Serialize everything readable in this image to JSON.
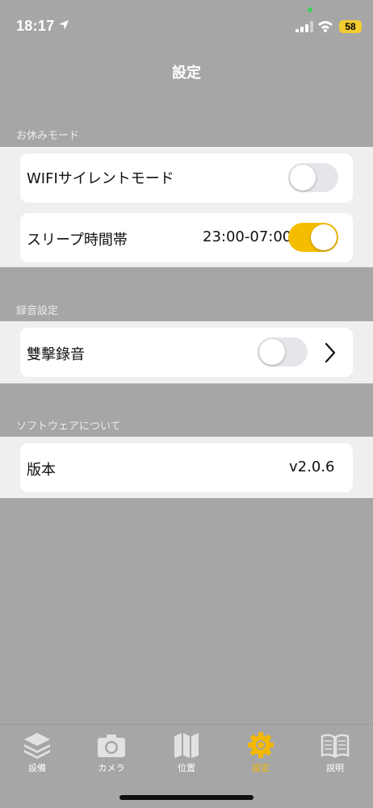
{
  "status_bar": {
    "time": "18:17",
    "battery": "58"
  },
  "header": {
    "title": "設定"
  },
  "sections": [
    {
      "header": "お休みモード",
      "rows": [
        {
          "label": "WIFIサイレントモード",
          "toggle": false
        },
        {
          "label": "スリープ時間帯",
          "value": "23:00-07:00",
          "toggle": true
        }
      ]
    },
    {
      "header": "録音設定",
      "rows": [
        {
          "label": "雙擊錄音",
          "toggle": false,
          "chevron": true
        }
      ]
    },
    {
      "header": "ソフトウェアについて",
      "rows": [
        {
          "label": "版本",
          "value": "v2.0.6"
        }
      ]
    }
  ],
  "tabbar": {
    "tabs": [
      {
        "label": "設備",
        "icon": "layers-icon"
      },
      {
        "label": "カメラ",
        "icon": "camera-icon"
      },
      {
        "label": "位置",
        "icon": "map-icon"
      },
      {
        "label": "設定",
        "icon": "gear-icon",
        "active": true
      },
      {
        "label": "説明",
        "icon": "book-icon"
      }
    ]
  },
  "colors": {
    "accent": "#f5bd00",
    "background": "#a6a6a6",
    "section": "#efefef"
  }
}
